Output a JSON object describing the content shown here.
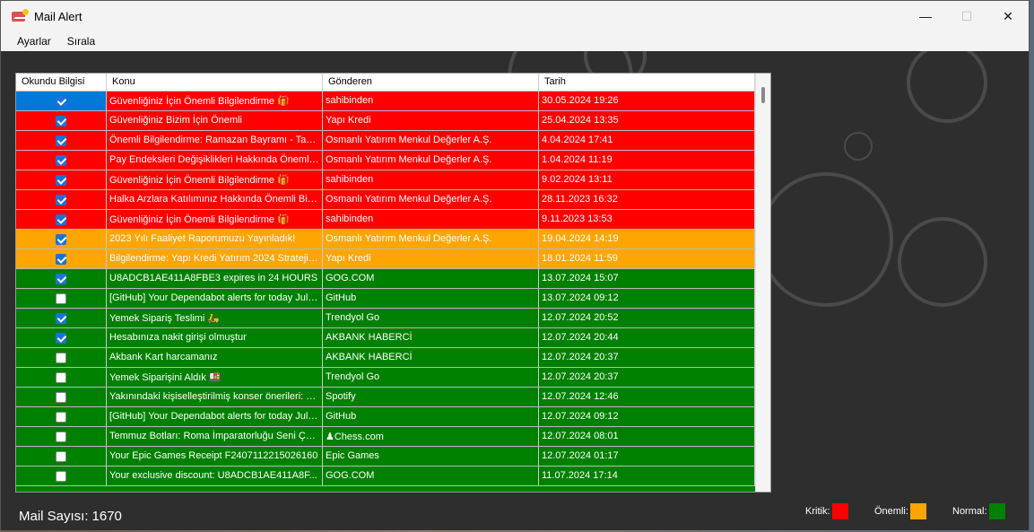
{
  "window": {
    "title": "Mail Alert",
    "minimize": "—",
    "maximize": "☐",
    "close": "✕"
  },
  "menu": [
    "Ayarlar",
    "Sırala"
  ],
  "grid": {
    "headers": [
      "Okundu Bilgisi",
      "Konu",
      "Gönderen",
      "Tarih"
    ],
    "rows": [
      {
        "read": true,
        "subject": "Güvenliğiniz İçin Önemli Bilgilendirme 🎁",
        "sender": "sahibinden",
        "date": "30.05.2024 19:26",
        "level": "kritik"
      },
      {
        "read": true,
        "subject": "Güvenliğiniz Bizim İçin Önemli",
        "sender": "Yapı Kredi",
        "date": "25.04.2024 13:35",
        "level": "kritik"
      },
      {
        "read": true,
        "subject": "Önemli Bilgilendirme: Ramazan Bayramı - Takas...",
        "sender": "Osmanlı Yatırım Menkul Değerler A.Ş.",
        "date": "4.04.2024 17:41",
        "level": "kritik"
      },
      {
        "read": true,
        "subject": "Pay Endeksleri Değişiklikleri Hakkında Önemli ...",
        "sender": "Osmanlı Yatırım Menkul Değerler A.Ş.",
        "date": "1.04.2024 11:19",
        "level": "kritik"
      },
      {
        "read": true,
        "subject": "Güvenliğiniz İçin Önemli Bilgilendirme 🎁",
        "sender": "sahibinden",
        "date": "9.02.2024 13:11",
        "level": "kritik"
      },
      {
        "read": true,
        "subject": "Halka Arzlara Katılımınız Hakkında Önemli Bilgil...",
        "sender": "Osmanlı Yatırım Menkul Değerler A.Ş.",
        "date": "28.11.2023 16:32",
        "level": "kritik"
      },
      {
        "read": true,
        "subject": "Güvenliğiniz İçin Önemli Bilgilendirme 🎁",
        "sender": "sahibinden",
        "date": "9.11.2023 13:53",
        "level": "kritik"
      },
      {
        "read": true,
        "subject": "2023 Yılı Faaliyet Raporumuzu Yayınladık!",
        "sender": "Osmanlı Yatırım Menkul Değerler A.Ş.",
        "date": "19.04.2024 14:19",
        "level": "onemli"
      },
      {
        "read": true,
        "subject": "Bilgilendirme: Yapı Kredi Yatırım 2024 Strateji R...",
        "sender": "Yapı Kredi",
        "date": "18.01.2024 11:59",
        "level": "onemli"
      },
      {
        "read": true,
        "subject": "U8ADCB1AE411A8FBE3 expires in 24 HOURS",
        "sender": "GOG.COM",
        "date": "13.07.2024 15:07",
        "level": "normal"
      },
      {
        "read": false,
        "subject": "[GitHub] Your Dependabot alerts for today Jul 13",
        "sender": "GitHub",
        "date": "13.07.2024 09:12",
        "level": "normal"
      },
      {
        "read": true,
        "subject": "Yemek Sipariş Teslimi 🛵",
        "sender": "Trendyol Go",
        "date": "12.07.2024 20:52",
        "level": "normal"
      },
      {
        "read": true,
        "subject": "Hesabınıza nakit girişi olmuştur",
        "sender": "AKBANK HABERCİ",
        "date": "12.07.2024 20:44",
        "level": "normal"
      },
      {
        "read": false,
        "subject": "Akbank Kart harcamanız",
        "sender": "AKBANK HABERCİ",
        "date": "12.07.2024 20:37",
        "level": "normal"
      },
      {
        "read": false,
        "subject": "Yemek Siparişini Aldık 🍱",
        "sender": "Trendyol Go",
        "date": "12.07.2024 20:37",
        "level": "normal"
      },
      {
        "read": false,
        "subject": "Yakınındaki kişiselleştirilmiş konser önerileri: Dol...",
        "sender": "Spotify",
        "date": "12.07.2024 12:46",
        "level": "normal"
      },
      {
        "read": false,
        "subject": "[GitHub] Your Dependabot alerts for today Jul 12",
        "sender": "GitHub",
        "date": "12.07.2024 09:12",
        "level": "normal"
      },
      {
        "read": false,
        "subject": "Temmuz Botları: Roma İmparatorluğu Seni Çağır...",
        "sender": "♟Chess.com",
        "date": "12.07.2024 08:01",
        "level": "normal"
      },
      {
        "read": false,
        "subject": "Your Epic Games Receipt F2407112215026160",
        "sender": "Epic Games",
        "date": "12.07.2024 01:17",
        "level": "normal"
      },
      {
        "read": false,
        "subject": "Your exclusive discount: U8ADCB1AE411A8F...",
        "sender": "GOG.COM",
        "date": "11.07.2024 17:14",
        "level": "normal"
      }
    ]
  },
  "colors": {
    "kritik": "#ff0000",
    "onemli": "#ffa500",
    "normal": "#008000",
    "selected": "#0078d7"
  },
  "footer": {
    "count_label": "Mail Sayısı:",
    "count_value": "1670",
    "legend": [
      {
        "label": "Kritik:",
        "level": "kritik"
      },
      {
        "label": "Önemli:",
        "level": "onemli"
      },
      {
        "label": "Normal:",
        "level": "normal"
      }
    ]
  }
}
